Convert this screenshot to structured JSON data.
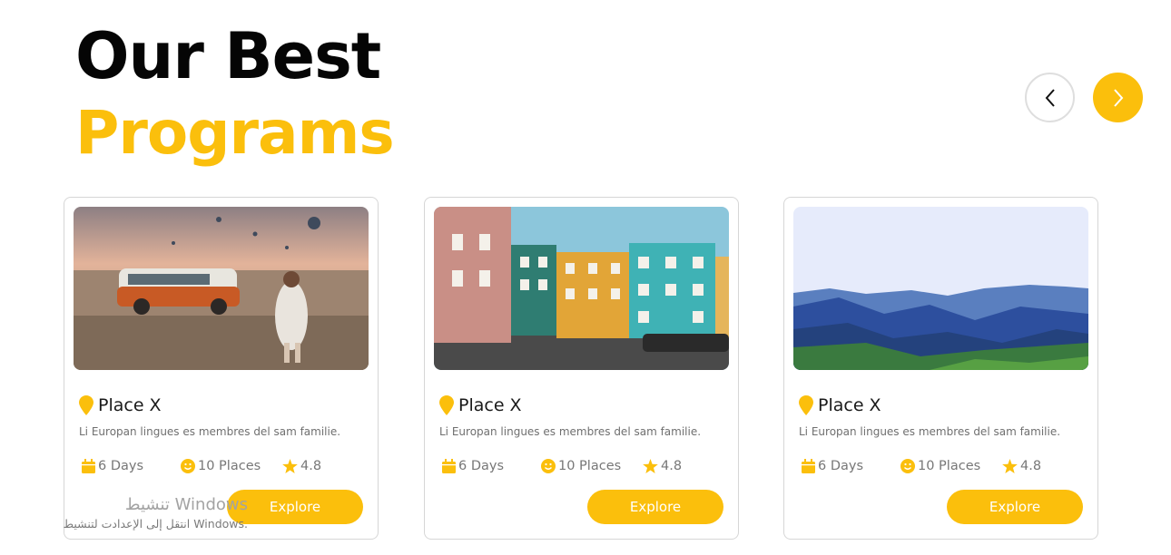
{
  "heading": {
    "line1": "Our Best",
    "line2": "Programs"
  },
  "navigation": {
    "prev_icon": "chevron-left-icon",
    "next_icon": "chevron-right-icon"
  },
  "cards": [
    {
      "image": "van-balloons-photo",
      "title": "Place X",
      "description": "Li Europan lingues es membres del sam familie.",
      "days": "6 Days",
      "places": "10 Places",
      "rating": "4.8",
      "button": "Explore"
    },
    {
      "image": "colorful-houses-photo",
      "title": "Place X",
      "description": "Li Europan lingues es membres del sam familie.",
      "days": "6 Days",
      "places": "10 Places",
      "rating": "4.8",
      "button": "Explore"
    },
    {
      "image": "mountains-photo",
      "title": "Place X",
      "description": "Li Europan lingues es membres del sam familie.",
      "days": "6 Days",
      "places": "10 Places",
      "rating": "4.8",
      "button": "Explore"
    }
  ],
  "watermark": {
    "line1": "تنشيط Windows",
    "line2": "انتقل إلى الإعدادت لتنشيط Windows."
  },
  "colors": {
    "accent": "#fbbf0c",
    "heading": "#050505"
  }
}
